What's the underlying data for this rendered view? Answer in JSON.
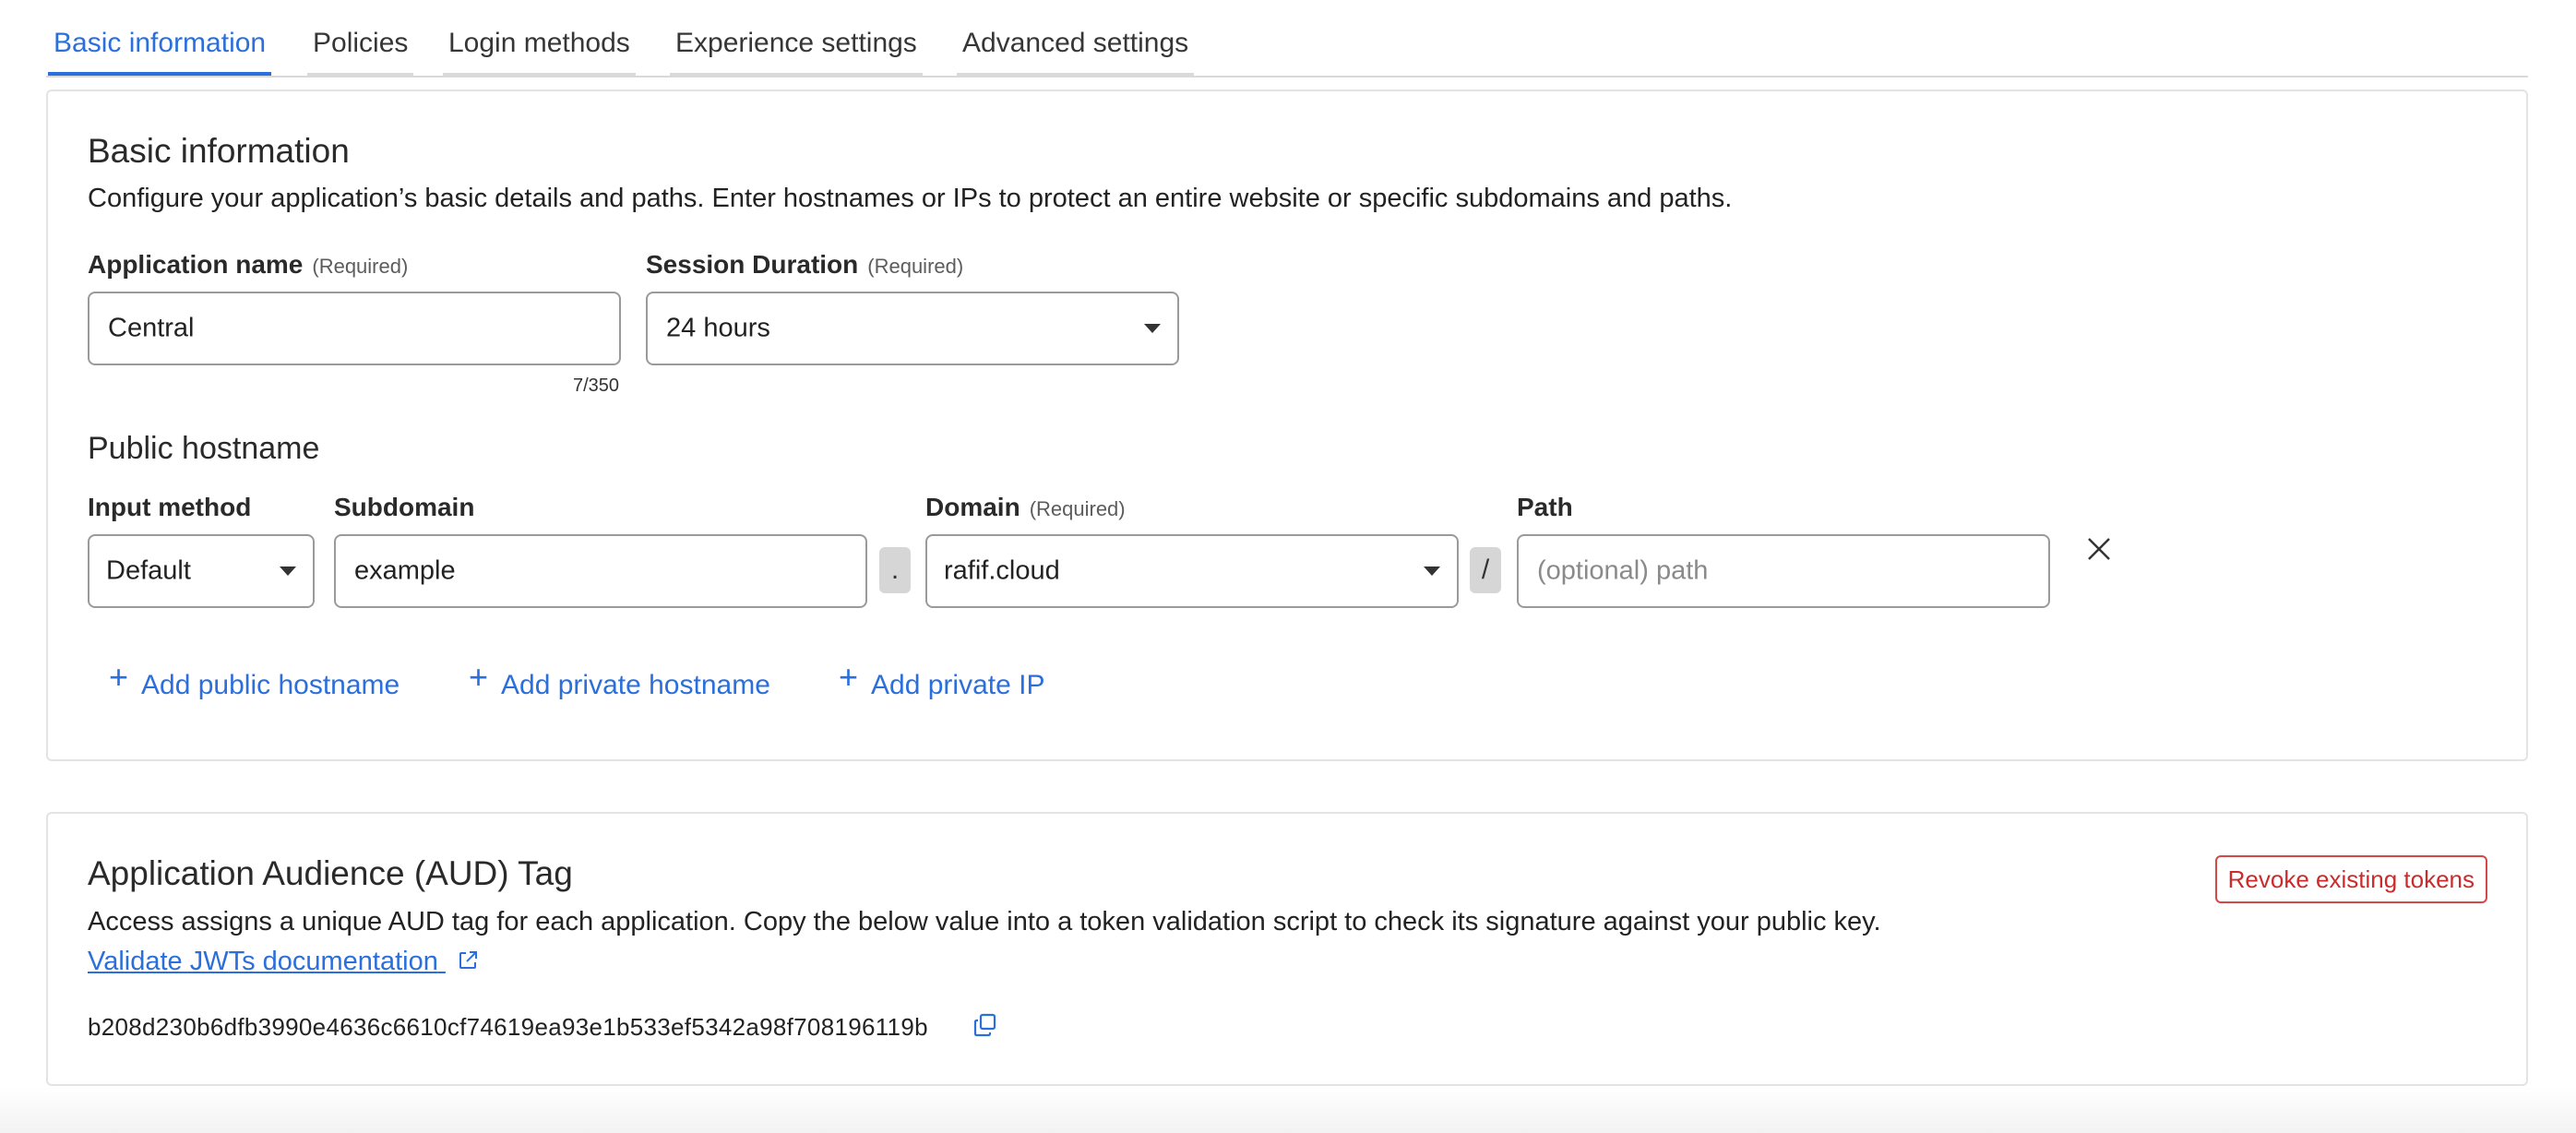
{
  "tabs": [
    {
      "label": "Basic information",
      "active": true
    },
    {
      "label": "Policies",
      "active": false
    },
    {
      "label": "Login methods",
      "active": false
    },
    {
      "label": "Experience settings",
      "active": false
    },
    {
      "label": "Advanced settings",
      "active": false
    }
  ],
  "basic": {
    "title": "Basic information",
    "description": "Configure your application’s basic details and paths. Enter hostnames or IPs to protect an entire website or specific subdomains and paths.",
    "app_name_label": "Application name",
    "app_name_required": "(Required)",
    "app_name_value": "Central",
    "app_name_counter": "7/350",
    "session_label": "Session Duration",
    "session_required": "(Required)",
    "session_value": "24 hours"
  },
  "hostname": {
    "title": "Public hostname",
    "input_method_label": "Input method",
    "input_method_value": "Default",
    "subdomain_label": "Subdomain",
    "subdomain_value": "example",
    "dot": ".",
    "domain_label": "Domain",
    "domain_required": "(Required)",
    "domain_value": "rafif.cloud",
    "slash": "/",
    "path_label": "Path",
    "path_placeholder": "(optional) path",
    "add_public": "Add public hostname",
    "add_private_hostname": "Add private hostname",
    "add_private_ip": "Add private IP"
  },
  "aud": {
    "title": "Application Audience (AUD) Tag",
    "description": "Access assigns a unique AUD tag for each application. Copy the below value into a token validation script to check its signature against your public key.",
    "doc_link": "Validate JWTs documentation",
    "tag_value": "b208d230b6dfb3990e4636c6610cf74619ea93e1b533ef5342a98f708196119b",
    "revoke_label": "Revoke existing tokens"
  },
  "colors": {
    "accent": "#2a6fdb",
    "danger": "#cc2b2b"
  },
  "icons": [
    "chevron-down-icon",
    "close-icon",
    "plus-icon",
    "external-link-icon",
    "copy-icon"
  ]
}
